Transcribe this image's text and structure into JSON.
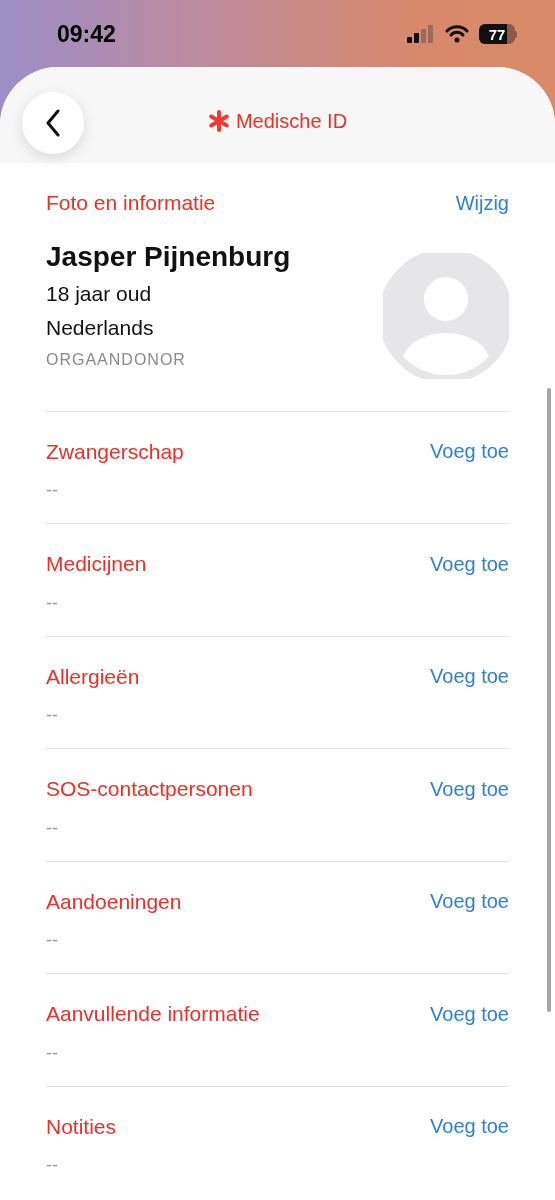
{
  "status_bar": {
    "time": "09:42",
    "battery": "77"
  },
  "header": {
    "title": "Medische ID"
  },
  "profile": {
    "section_title": "Foto en informatie",
    "action": "Wijzig",
    "name": "Jasper Pijnenburg",
    "age": "18 jaar oud",
    "nationality": "Nederlands",
    "donor": "ORGAANDONOR"
  },
  "sections": [
    {
      "title": "Zwangerschap",
      "action": "Voeg toe",
      "value": "--"
    },
    {
      "title": "Medicijnen",
      "action": "Voeg toe",
      "value": "--"
    },
    {
      "title": "Allergieën",
      "action": "Voeg toe",
      "value": "--"
    },
    {
      "title": "SOS-contactpersonen",
      "action": "Voeg toe",
      "value": "--"
    },
    {
      "title": "Aandoeningen",
      "action": "Voeg toe",
      "value": "--"
    },
    {
      "title": "Aanvullende informatie",
      "action": "Voeg toe",
      "value": "--"
    },
    {
      "title": "Notities",
      "action": "Voeg toe",
      "value": "--"
    }
  ]
}
